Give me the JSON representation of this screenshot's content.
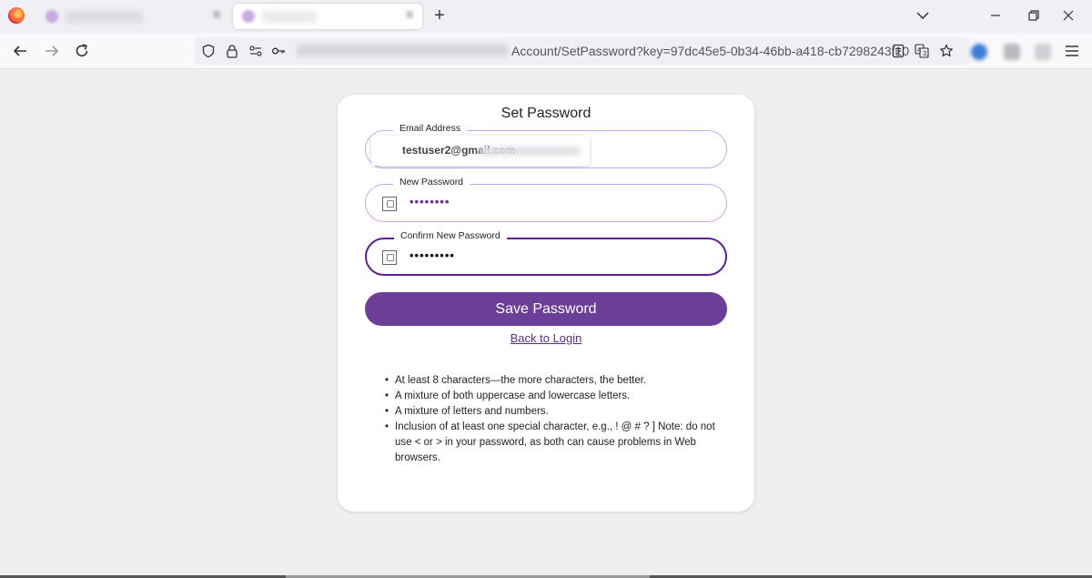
{
  "browser": {
    "url_visible": "Account/SetPassword?key=97dc45e5-0b34-46bb-a418-cb7298243f10",
    "new_tab_label": "+",
    "icons": [
      "firefox-icon",
      "back-icon",
      "forward-icon",
      "reload-icon",
      "shield-icon",
      "lock-icon",
      "permissions-icon",
      "key-icon",
      "reader-view-icon",
      "translate-icon",
      "bookmark-star-icon",
      "menu-icon",
      "minimize-icon",
      "maximize-icon",
      "close-icon",
      "list-tabs-icon"
    ]
  },
  "form": {
    "title": "Set Password",
    "email": {
      "label": "Email Address",
      "value": "testuser2@gmail.com"
    },
    "new_password": {
      "label": "New Password",
      "value": "••••••••"
    },
    "confirm_password": {
      "label": "Confirm New Password",
      "value": "•••••••••"
    },
    "save_label": "Save Password",
    "back_label": "Back to Login"
  },
  "rules": [
    "At least 8 characters—the more characters, the better.",
    "A mixture of both uppercase and lowercase letters.",
    "A mixture of letters and numbers.",
    "Inclusion of at least one special character, e.g., ! @ # ? ] Note: do not use < or > in your password, as both can cause problems in Web browsers."
  ],
  "colors": {
    "primary": "#6b3e98",
    "field_border": "#c9a9e6",
    "focus_border": "#5b1f9a",
    "background": "#efefef"
  }
}
